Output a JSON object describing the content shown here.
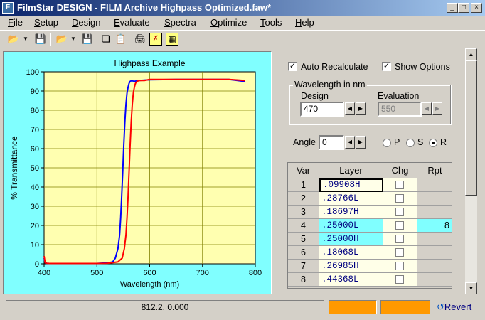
{
  "window": {
    "title": "FilmStar DESIGN - FILM Archive Highpass Optimized.faw*",
    "controls": [
      "_",
      "□",
      "×"
    ]
  },
  "menu": [
    {
      "label": "File",
      "u": "F",
      "rest": "ile"
    },
    {
      "label": "Setup",
      "u": "S",
      "rest": "etup"
    },
    {
      "label": "Design",
      "u": "D",
      "rest": "esign"
    },
    {
      "label": "Evaluate",
      "u": "E",
      "rest": "valuate"
    },
    {
      "label": "Spectra",
      "u": "S",
      "rest": "pectra"
    },
    {
      "label": "Optimize",
      "u": "O",
      "rest": "ptimize"
    },
    {
      "label": "Tools",
      "u": "T",
      "rest": "ools"
    },
    {
      "label": "Help",
      "u": "H",
      "rest": "elp"
    }
  ],
  "toolbar": {
    "icons": [
      "open-folder-icon",
      "dropdown-arrow-icon",
      "save-disk-icon",
      "open-folder-icon",
      "dropdown-arrow-icon",
      "save-disk-icon",
      "copy-icon",
      "paste-icon",
      "print-icon",
      "chart-icon",
      "table-grid-icon"
    ]
  },
  "options": {
    "auto_recalc": {
      "label": "Auto Recalculate",
      "checked": true
    },
    "show_options": {
      "label": "Show Options",
      "checked": true
    }
  },
  "wavelength": {
    "group_label": "Wavelength in nm",
    "design_label": "Design",
    "design_value": "470",
    "eval_label": "Evaluation",
    "eval_value": "550"
  },
  "angle": {
    "label": "Angle",
    "value": "0",
    "pol": [
      {
        "label": "P",
        "checked": false
      },
      {
        "label": "S",
        "checked": false
      },
      {
        "label": "R",
        "checked": true
      }
    ]
  },
  "grid": {
    "headers": [
      "Var",
      "Layer",
      "Chg",
      "Rpt"
    ],
    "rows": [
      {
        "var": "1",
        "layer": ".09908H",
        "rpt": "",
        "hl": false,
        "sel": true
      },
      {
        "var": "2",
        "layer": ".28766L",
        "rpt": "",
        "hl": false,
        "sel": false
      },
      {
        "var": "3",
        "layer": ".18697H",
        "rpt": "",
        "hl": false,
        "sel": false
      },
      {
        "var": "4",
        "layer": ".25000L",
        "rpt": "8",
        "hl": true,
        "sel": false
      },
      {
        "var": "5",
        "layer": ".25000H",
        "rpt": "",
        "hl": true,
        "sel": false
      },
      {
        "var": "6",
        "layer": ".18068L",
        "rpt": "",
        "hl": false,
        "sel": false
      },
      {
        "var": "7",
        "layer": ".26985H",
        "rpt": "",
        "hl": false,
        "sel": false
      },
      {
        "var": "8",
        "layer": ".44368L",
        "rpt": "",
        "hl": false,
        "sel": false
      }
    ]
  },
  "status": {
    "coords": "812.2, 0.000",
    "revert_label": "Revert",
    "indicator_color": "#ff9900"
  },
  "chart_data": {
    "type": "line",
    "title": "Highpass Example",
    "xlabel": "Wavelength (nm)",
    "ylabel": "% Transmittance",
    "xlim": [
      400,
      800
    ],
    "ylim": [
      0,
      100
    ],
    "xticks": [
      400,
      500,
      600,
      700,
      800
    ],
    "yticks": [
      0,
      10,
      20,
      30,
      40,
      50,
      60,
      70,
      80,
      90,
      100
    ],
    "grid": true,
    "plot_bg": "#ffffb0",
    "series": [
      {
        "color": "#0000ff",
        "x": [
          400,
          402,
          405,
          410,
          420,
          440,
          460,
          480,
          500,
          520,
          530,
          535,
          540,
          543,
          545,
          547,
          549,
          551,
          553,
          555,
          557,
          559,
          561,
          563,
          566,
          570,
          580,
          600,
          650,
          700,
          750,
          780
        ],
        "y": [
          3,
          0.5,
          0.3,
          0.2,
          0.2,
          0.2,
          0.2,
          0.2,
          0.2,
          0.5,
          1,
          3,
          8,
          15,
          24,
          35,
          48,
          62,
          74,
          83,
          89,
          92,
          94,
          95,
          95.5,
          95,
          95.5,
          95.8,
          96,
          96,
          96,
          95
        ]
      },
      {
        "color": "#ff0000",
        "x": [
          400,
          402,
          405,
          410,
          420,
          440,
          460,
          480,
          500,
          520,
          540,
          548,
          552,
          555,
          557,
          559,
          561,
          563,
          565,
          567,
          569,
          571,
          573,
          576,
          580,
          590,
          600,
          650,
          700,
          750,
          780
        ],
        "y": [
          4,
          0.5,
          0.3,
          0.2,
          0.2,
          0.2,
          0.2,
          0.2,
          0.2,
          0.3,
          1,
          3,
          8,
          15,
          24,
          35,
          48,
          62,
          74,
          83,
          89,
          92,
          94,
          95,
          95.5,
          95.5,
          96,
          96,
          96,
          96,
          95.5
        ]
      }
    ]
  }
}
